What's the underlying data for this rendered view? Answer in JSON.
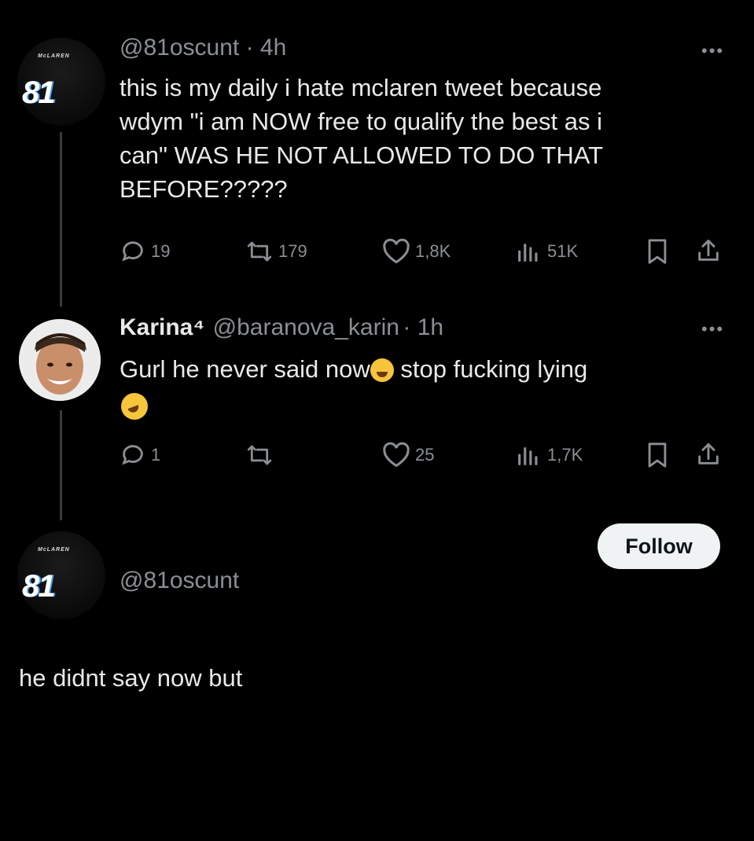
{
  "tweet1": {
    "handle": "@81oscunt",
    "time": "· 4h",
    "text": "this is my daily i hate mclaren tweet because\nwdym \"i am NOW free to qualify the best as i\ncan\" WAS HE NOT ALLOWED TO DO THAT\nBEFORE?????",
    "more": "•••",
    "avatar": {
      "number": "81",
      "brand": "McLAREN"
    },
    "replies": "19",
    "retweets": "179",
    "likes": "1,8K",
    "views": "51K"
  },
  "tweet2": {
    "name": "Karina⁴",
    "handle": "@baranova_karin",
    "time": "· 1h",
    "text_part1": "Gurl he never said now",
    "text_part2": " stop fucking lying",
    "more": "•••",
    "replies": "1",
    "retweets": "",
    "likes": "25",
    "views": "1,7K"
  },
  "reply": {
    "handle": "@81oscunt",
    "avatar": {
      "number": "81",
      "brand": "McLAREN"
    },
    "follow_label": "Follow",
    "text": "he didnt say now but"
  },
  "colors": {
    "background": "#000000",
    "text": "#e7e9ea",
    "muted": "#8b8f94",
    "follow_bg": "#eff3f4"
  }
}
